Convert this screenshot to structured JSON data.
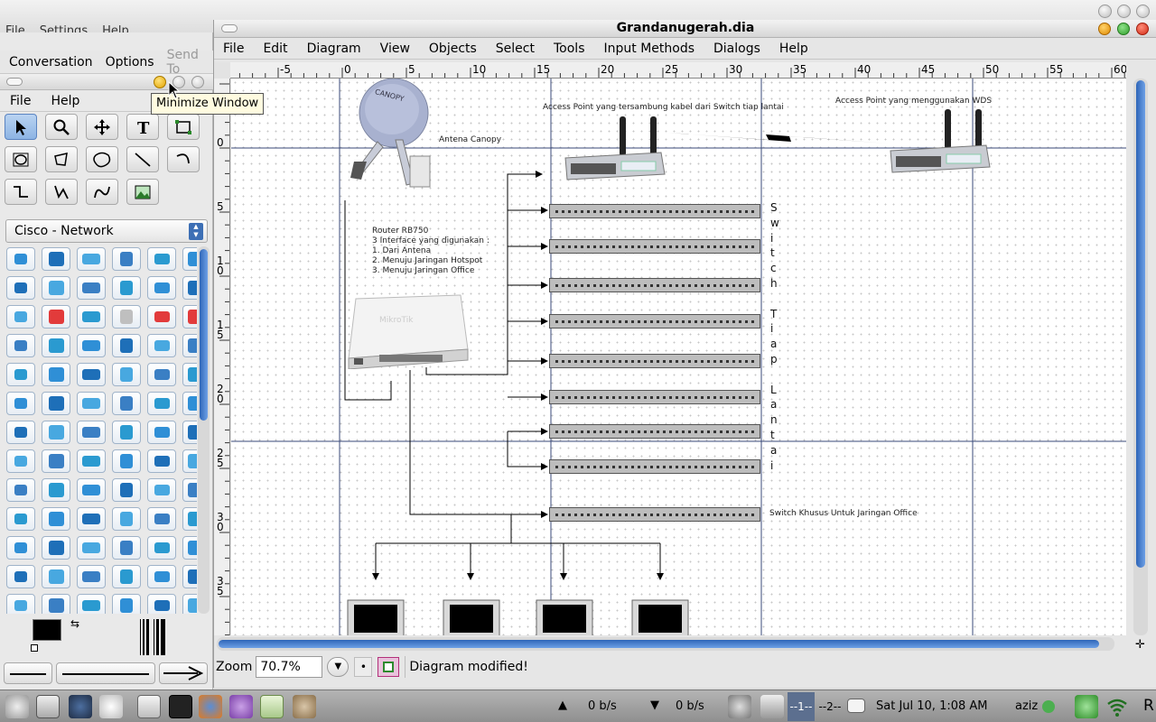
{
  "background_window": {
    "menu": [
      "File",
      "Settings",
      "Help"
    ]
  },
  "chat_window": {
    "menu": [
      "Conversation",
      "Options",
      "Send To"
    ]
  },
  "toolbox": {
    "menu": [
      "File",
      "Help"
    ],
    "sheet": "Cisco - Network",
    "tooltip": "Minimize Window"
  },
  "dia": {
    "title": "Grandanugerah.dia",
    "menu": [
      "File",
      "Edit",
      "Diagram",
      "View",
      "Objects",
      "Select",
      "Tools",
      "Input Methods",
      "Dialogs",
      "Help"
    ],
    "hruler_labels": [
      "-5",
      "0",
      "5",
      "10",
      "15",
      "20",
      "25",
      "30",
      "35",
      "40",
      "45",
      "50",
      "55",
      "60"
    ],
    "vruler_labels": [
      "0",
      "5",
      "10",
      "15",
      "20",
      "25",
      "30",
      "35"
    ],
    "zoom_label": "Zoom",
    "zoom_value": "70.7%",
    "status": "Diagram modified!"
  },
  "diagram": {
    "antenna_label": "Antena Canopy",
    "antenna_brand": "CANOPY",
    "ap_label_1": "Access Point yang tersambung kabel dari Switch tiap lantai",
    "ap_label_2": "Access Point yang menggunakan WDS",
    "router_lines": [
      "Router RB750",
      "3 Interface yang digunakan :",
      "1. Dari Antena",
      "2. Menuju Jaringan Hotspot",
      "3. Menuju Jaringan Office"
    ],
    "router_brand": "MikroTik",
    "vertical_text": [
      "S",
      "w",
      "i",
      "t",
      "c",
      "h",
      "",
      "T",
      "i",
      "a",
      "p",
      "",
      "L",
      "a",
      "n",
      "t",
      "a",
      "i"
    ],
    "office_switch_label": "Switch Khusus Untuk Jaringan Office"
  },
  "taskbar": {
    "net_up": "0 b/s",
    "net_down": "0 b/s",
    "workspace_1": "--1--",
    "workspace_2": "--2--",
    "datetime": "Sat Jul 10,  1:08 AM",
    "user": "aziz",
    "tail": "R"
  },
  "colors": {
    "accent_blue": "#3d6fb5",
    "status_ok": "#4caf50"
  }
}
